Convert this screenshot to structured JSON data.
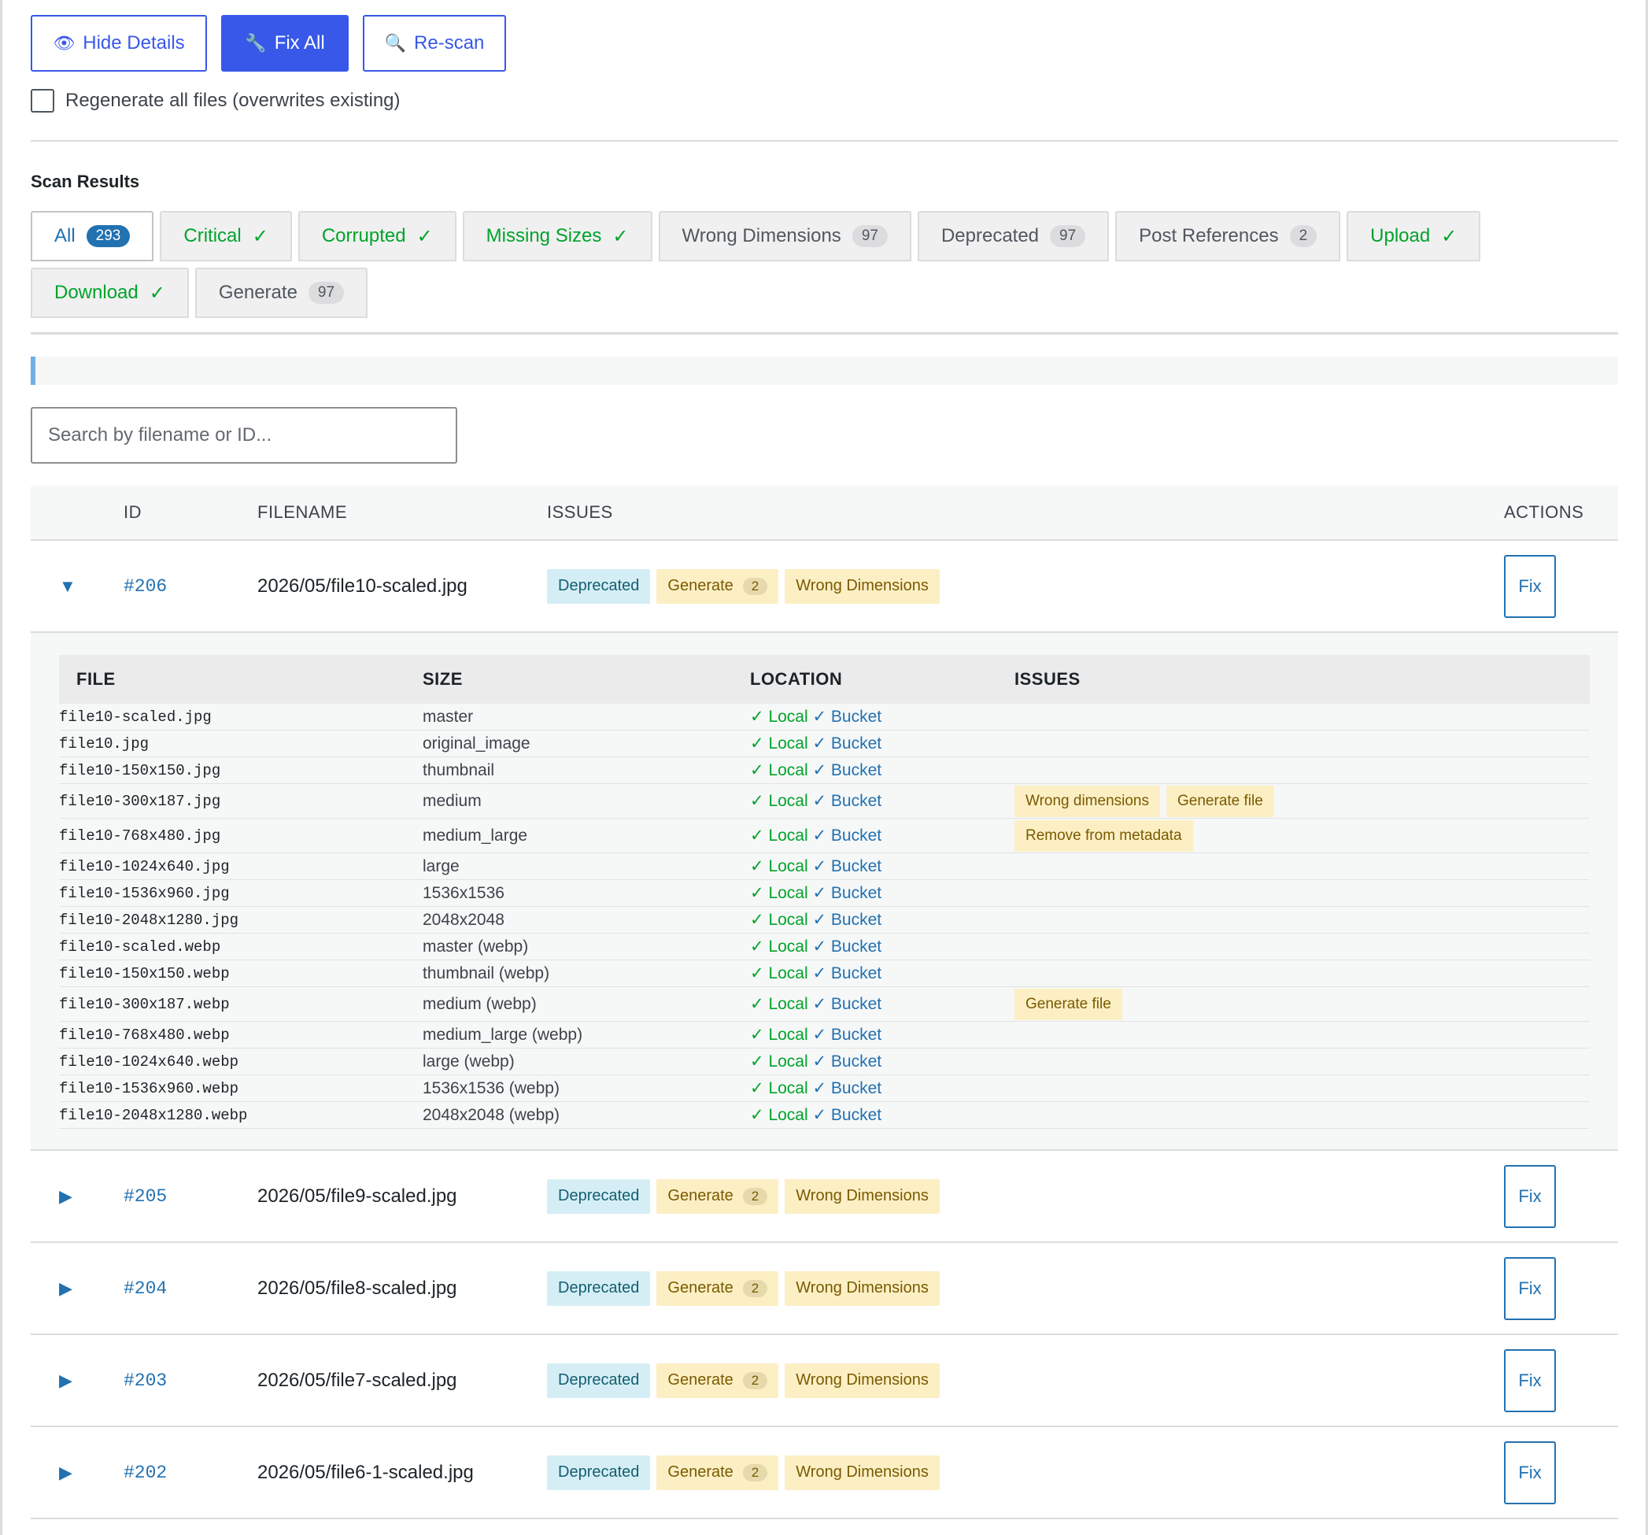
{
  "toolbar": {
    "hide_details": "Hide Details",
    "fix_all": "Fix All",
    "rescan": "Re-scan",
    "regenerate_label": "Regenerate all files (overwrites existing)"
  },
  "scan": {
    "title": "Scan Results",
    "tabs": [
      {
        "label": "All",
        "count": "293",
        "state": "active"
      },
      {
        "label": "Critical",
        "check": "✓",
        "state": "ok"
      },
      {
        "label": "Corrupted",
        "check": "✓",
        "state": "ok"
      },
      {
        "label": "Missing Sizes",
        "check": "✓",
        "state": "ok"
      },
      {
        "label": "Wrong Dimensions",
        "count": "97",
        "state": "normal"
      },
      {
        "label": "Deprecated",
        "count": "97",
        "state": "normal"
      },
      {
        "label": "Post References",
        "count": "2",
        "state": "normal"
      },
      {
        "label": "Upload",
        "check": "✓",
        "state": "ok"
      },
      {
        "label": "Download",
        "check": "✓",
        "state": "ok"
      },
      {
        "label": "Generate",
        "count": "97",
        "state": "normal"
      }
    ],
    "progress_fraction": 0.003
  },
  "search": {
    "placeholder": "Search by filename or ID..."
  },
  "table": {
    "headers": {
      "id": "ID",
      "filename": "FILENAME",
      "issues": "ISSUES",
      "actions": "ACTIONS"
    },
    "fix_label": "Fix",
    "rows": [
      {
        "toggle": "▼",
        "id": "#206",
        "filename": "2026/05/file10-scaled.jpg",
        "expanded": true,
        "issues": [
          {
            "label": "Deprecated",
            "kind": "dep"
          },
          {
            "label": "Generate",
            "count": "2",
            "kind": "warn"
          },
          {
            "label": "Wrong Dimensions",
            "kind": "warn"
          }
        ]
      },
      {
        "toggle": "▶",
        "id": "#205",
        "filename": "2026/05/file9-scaled.jpg",
        "expanded": false,
        "issues": [
          {
            "label": "Deprecated",
            "kind": "dep"
          },
          {
            "label": "Generate",
            "count": "2",
            "kind": "warn"
          },
          {
            "label": "Wrong Dimensions",
            "kind": "warn"
          }
        ]
      },
      {
        "toggle": "▶",
        "id": "#204",
        "filename": "2026/05/file8-scaled.jpg",
        "expanded": false,
        "issues": [
          {
            "label": "Deprecated",
            "kind": "dep"
          },
          {
            "label": "Generate",
            "count": "2",
            "kind": "warn"
          },
          {
            "label": "Wrong Dimensions",
            "kind": "warn"
          }
        ]
      },
      {
        "toggle": "▶",
        "id": "#203",
        "filename": "2026/05/file7-scaled.jpg",
        "expanded": false,
        "issues": [
          {
            "label": "Deprecated",
            "kind": "dep"
          },
          {
            "label": "Generate",
            "count": "2",
            "kind": "warn"
          },
          {
            "label": "Wrong Dimensions",
            "kind": "warn"
          }
        ]
      },
      {
        "toggle": "▶",
        "id": "#202",
        "filename": "2026/05/file6-1-scaled.jpg",
        "expanded": false,
        "issues": [
          {
            "label": "Deprecated",
            "kind": "dep"
          },
          {
            "label": "Generate",
            "count": "2",
            "kind": "warn"
          },
          {
            "label": "Wrong Dimensions",
            "kind": "warn"
          }
        ]
      }
    ]
  },
  "details": {
    "headers": {
      "file": "FILE",
      "size": "SIZE",
      "location": "LOCATION",
      "issues": "ISSUES"
    },
    "local_label": "Local",
    "bucket_label": "Bucket",
    "check": "✓",
    "files": [
      {
        "file": "file10-scaled.jpg",
        "size": "master",
        "issues": []
      },
      {
        "file": "file10.jpg",
        "size": "original_image",
        "issues": []
      },
      {
        "file": "file10-150x150.jpg",
        "size": "thumbnail",
        "issues": []
      },
      {
        "file": "file10-300x187.jpg",
        "size": "medium",
        "issues": [
          "Wrong dimensions",
          "Generate file"
        ]
      },
      {
        "file": "file10-768x480.jpg",
        "size": "medium_large",
        "issues": [
          "Remove from metadata"
        ]
      },
      {
        "file": "file10-1024x640.jpg",
        "size": "large",
        "issues": []
      },
      {
        "file": "file10-1536x960.jpg",
        "size": "1536x1536",
        "issues": []
      },
      {
        "file": "file10-2048x1280.jpg",
        "size": "2048x2048",
        "issues": []
      },
      {
        "file": "file10-scaled.webp",
        "size": "master (webp)",
        "issues": []
      },
      {
        "file": "file10-150x150.webp",
        "size": "thumbnail (webp)",
        "issues": []
      },
      {
        "file": "file10-300x187.webp",
        "size": "medium (webp)",
        "issues": [
          "Generate file"
        ]
      },
      {
        "file": "file10-768x480.webp",
        "size": "medium_large (webp)",
        "issues": []
      },
      {
        "file": "file10-1024x640.webp",
        "size": "large (webp)",
        "issues": []
      },
      {
        "file": "file10-1536x960.webp",
        "size": "1536x1536 (webp)",
        "issues": []
      },
      {
        "file": "file10-2048x1280.webp",
        "size": "2048x2048 (webp)",
        "issues": []
      }
    ]
  },
  "icons": {
    "hide": "eye-icon",
    "fix": "wrench-icon",
    "rescan": "magnifier-icon"
  },
  "colors": {
    "accent": "#3858e9",
    "link": "#2271b1",
    "ok": "#00a32a",
    "deprecated_bg": "#d5eef5",
    "warn_bg": "#fcefc4"
  }
}
